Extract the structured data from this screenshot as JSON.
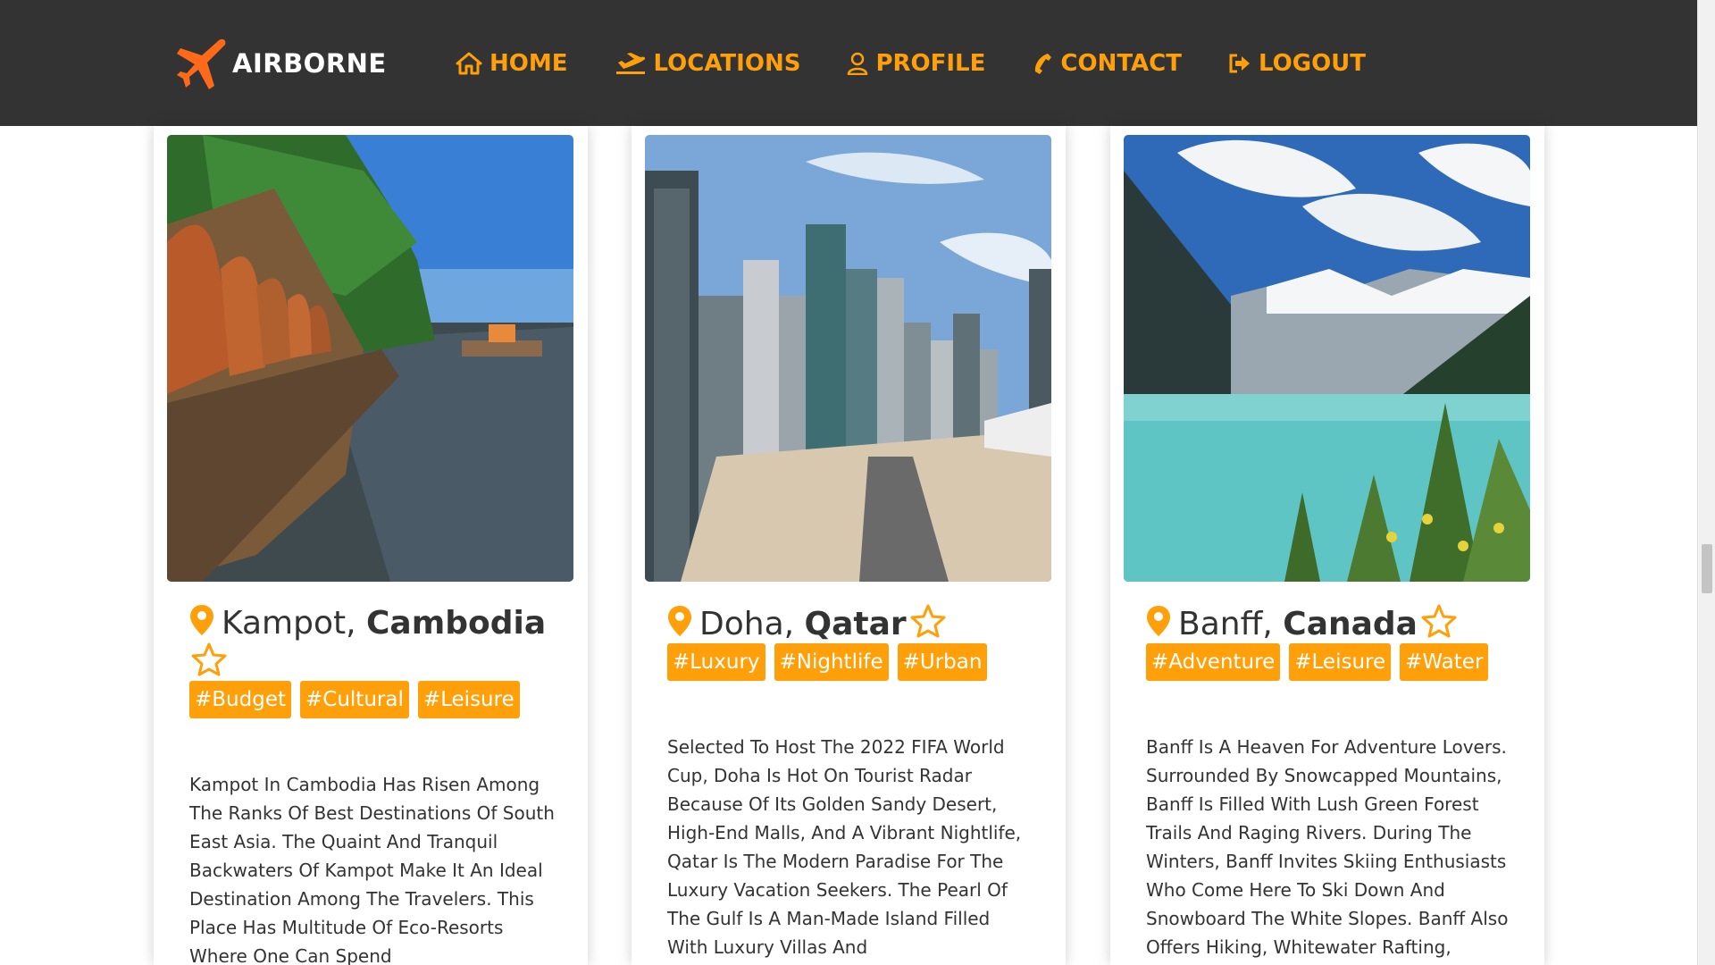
{
  "brand": {
    "name": "AIRBORNE"
  },
  "nav": [
    {
      "label": "HOME",
      "icon": "home-icon"
    },
    {
      "label": "LOCATIONS",
      "icon": "plane-departure-icon"
    },
    {
      "label": "PROFILE",
      "icon": "user-icon"
    },
    {
      "label": "CONTACT",
      "icon": "phone-icon"
    },
    {
      "label": "LOGOUT",
      "icon": "logout-icon"
    }
  ],
  "colors": {
    "accent": "#ff9f0a",
    "navbar": "#333333"
  },
  "cards": [
    {
      "city": "Kampot,",
      "country": "Cambodia",
      "tags": [
        "#Budget",
        "#Cultural",
        "#Leisure"
      ],
      "description": "Kampot In Cambodia Has Risen Among The Ranks Of Best Destinations Of South East Asia. The Quaint And Tranquil Backwaters Of Kampot Make It An Ideal Destination Among The Travelers. This Place Has Multitude Of Eco-Resorts Where One Can Spend"
    },
    {
      "city": "Doha,",
      "country": "Qatar",
      "tags": [
        "#Luxury",
        "#Nightlife",
        "#Urban"
      ],
      "description": "Selected To Host The 2022 FIFA World Cup, Doha Is Hot On Tourist Radar Because Of Its Golden Sandy Desert, High-End Malls, And A Vibrant Nightlife, Qatar Is The Modern Paradise For The Luxury Vacation Seekers. The Pearl Of The Gulf Is A Man-Made Island Filled With Luxury Villas And"
    },
    {
      "city": "Banff,",
      "country": "Canada",
      "tags": [
        "#Adventure",
        "#Leisure",
        "#Water"
      ],
      "description": "Banff Is A Heaven For Adventure Lovers. Surrounded By Snowcapped Mountains, Banff Is Filled With Lush Green Forest Trails And Raging Rivers. During The Winters, Banff Invites Skiing Enthusiasts Who Come Here To Ski Down And Snowboard The White Slopes. Banff Also Offers Hiking, Whitewater Rafting,"
    }
  ]
}
